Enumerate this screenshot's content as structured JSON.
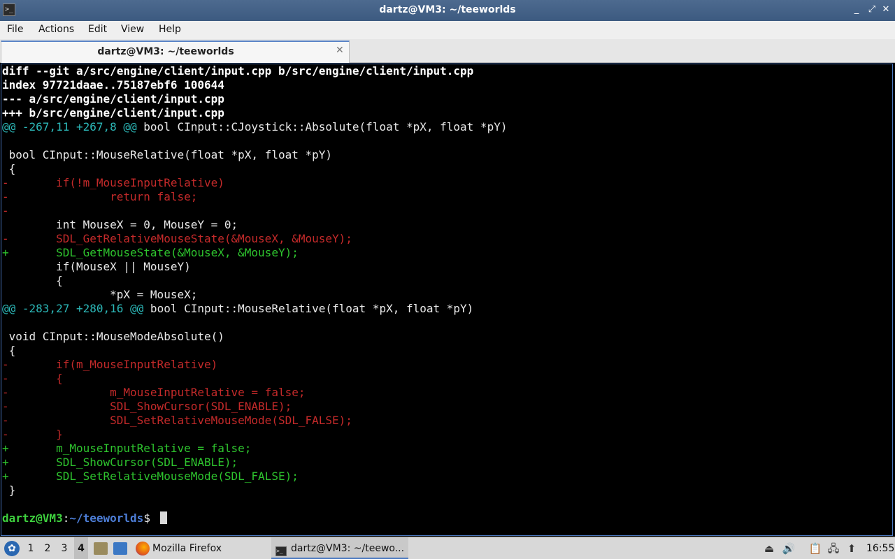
{
  "window": {
    "title": "dartz@VM3: ~/teeworlds",
    "app_icon": "terminal-icon",
    "controls": [
      "_",
      "⤢",
      "✕"
    ]
  },
  "menu": [
    "File",
    "Actions",
    "Edit",
    "View",
    "Help"
  ],
  "tab": {
    "label": "dartz@VM3: ~/teeworlds",
    "close": "✕"
  },
  "terminal": {
    "lines": [
      {
        "t": "bold",
        "text": "diff --git a/src/engine/client/input.cpp b/src/engine/client/input.cpp"
      },
      {
        "t": "bold",
        "text": "index 97721daae..75187ebf6 100644"
      },
      {
        "t": "bold",
        "text": "--- a/src/engine/client/input.cpp"
      },
      {
        "t": "bold",
        "text": "+++ b/src/engine/client/input.cpp"
      },
      {
        "t": "hunk",
        "text": "@@ -267,11 +267,8 @@",
        "rest": " bool CInput::CJoystick::Absolute(float *pX, float *pY)"
      },
      {
        "t": "ctx",
        "text": ""
      },
      {
        "t": "ctx",
        "text": " bool CInput::MouseRelative(float *pX, float *pY)"
      },
      {
        "t": "ctx",
        "text": " {"
      },
      {
        "t": "del",
        "text": "-       if(!m_MouseInputRelative)"
      },
      {
        "t": "del",
        "text": "-               return false;"
      },
      {
        "t": "del",
        "text": "-"
      },
      {
        "t": "ctx",
        "text": "        int MouseX = 0, MouseY = 0;"
      },
      {
        "t": "del",
        "text": "-       SDL_GetRelativeMouseState(&MouseX, &MouseY);"
      },
      {
        "t": "add",
        "text": "+       SDL_GetMouseState(&MouseX, &MouseY);"
      },
      {
        "t": "ctx",
        "text": "        if(MouseX || MouseY)"
      },
      {
        "t": "ctx",
        "text": "        {"
      },
      {
        "t": "ctx",
        "text": "                *pX = MouseX;"
      },
      {
        "t": "hunk",
        "text": "@@ -283,27 +280,16 @@",
        "rest": " bool CInput::MouseRelative(float *pX, float *pY)"
      },
      {
        "t": "ctx",
        "text": ""
      },
      {
        "t": "ctx",
        "text": " void CInput::MouseModeAbsolute()"
      },
      {
        "t": "ctx",
        "text": " {"
      },
      {
        "t": "del",
        "text": "-       if(m_MouseInputRelative)"
      },
      {
        "t": "del",
        "text": "-       {"
      },
      {
        "t": "del",
        "text": "-               m_MouseInputRelative = false;"
      },
      {
        "t": "del",
        "text": "-               SDL_ShowCursor(SDL_ENABLE);"
      },
      {
        "t": "del",
        "text": "-               SDL_SetRelativeMouseMode(SDL_FALSE);"
      },
      {
        "t": "del",
        "text": "-       }"
      },
      {
        "t": "add",
        "text": "+       m_MouseInputRelative = false;"
      },
      {
        "t": "add",
        "text": "+       SDL_ShowCursor(SDL_ENABLE);"
      },
      {
        "t": "add",
        "text": "+       SDL_SetRelativeMouseMode(SDL_FALSE);"
      },
      {
        "t": "ctx",
        "text": " }"
      },
      {
        "t": "ctx",
        "text": ""
      }
    ],
    "prompt": {
      "user": "dartz@VM3",
      "sep": ":",
      "path": "~/teeworlds",
      "symbol": "$ "
    }
  },
  "taskbar": {
    "start_icon": "lubuntu-start-icon",
    "workspaces": [
      "1",
      "2",
      "3",
      "4"
    ],
    "active_workspace": "4",
    "firefox_label": "Mozilla Firefox",
    "terminal_task_label": "dartz@VM3: ~/teewo...",
    "clock": "16:55"
  },
  "colors": {
    "titlebar": "#4d6a8f",
    "hunk": "#2cb8b8",
    "deletion": "#c42a2a",
    "addition": "#2ec42e",
    "prompt_user": "#3ed13e",
    "prompt_path": "#4d7ed8"
  }
}
